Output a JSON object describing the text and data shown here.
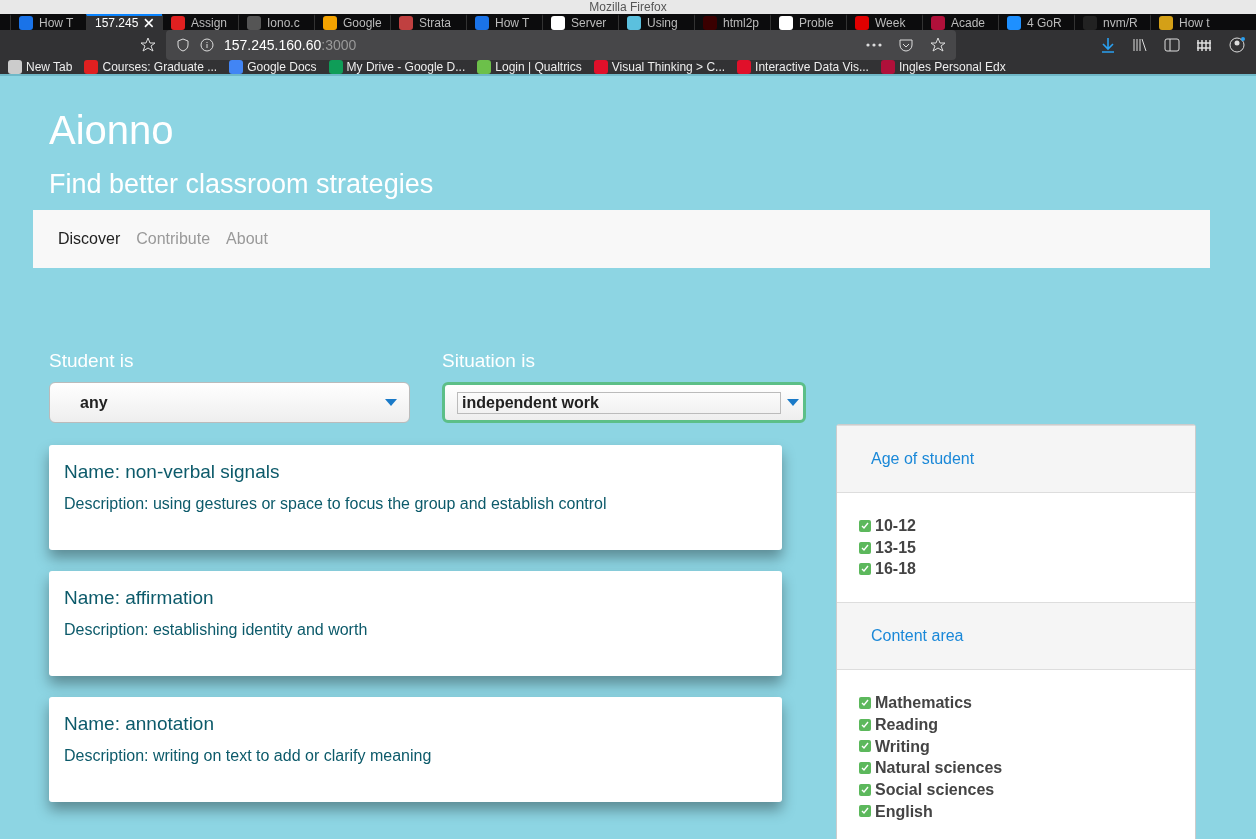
{
  "window": {
    "title": "Mozilla Firefox"
  },
  "tabs": [
    {
      "label": "How T",
      "selected": false,
      "color": "#1a73e8"
    },
    {
      "label": "157.245",
      "selected": true
    },
    {
      "label": "Assign",
      "selected": false,
      "color": "#e02020"
    },
    {
      "label": "Iono.c",
      "selected": false,
      "color": "#555555"
    },
    {
      "label": "Google",
      "selected": false,
      "color": "#f4a300"
    },
    {
      "label": "Strata",
      "selected": false,
      "color": "#c04040"
    },
    {
      "label": "How T",
      "selected": false,
      "color": "#1a73e8"
    },
    {
      "label": "Server",
      "selected": false,
      "color": "#ffffff"
    },
    {
      "label": "Using",
      "selected": false,
      "color": "#5bc0de"
    },
    {
      "label": "html2p",
      "selected": false,
      "color": "#3a0000"
    },
    {
      "label": "Proble",
      "selected": false,
      "color": "#ffffff"
    },
    {
      "label": "Week",
      "selected": false,
      "color": "#e00000"
    },
    {
      "label": "Acade",
      "selected": false,
      "color": "#b0103a"
    },
    {
      "label": "4 GoR",
      "selected": false,
      "color": "#1e90ff"
    },
    {
      "label": "nvm/R",
      "selected": false,
      "color": "#222222"
    },
    {
      "label": "How t",
      "selected": false,
      "color": "#d4a017"
    }
  ],
  "address": {
    "host": "157.245.160.60",
    "port": ":3000"
  },
  "bookmarks": [
    {
      "label": "New Tab",
      "color": "#cccccc"
    },
    {
      "label": "Courses: Graduate ...",
      "color": "#e02020"
    },
    {
      "label": "Google Docs",
      "color": "#4285f4"
    },
    {
      "label": "My Drive - Google D...",
      "color": "#0f9d58"
    },
    {
      "label": "Login | Qualtrics",
      "color": "#6cc04a"
    },
    {
      "label": "Visual Thinking > C...",
      "color": "#e0102a"
    },
    {
      "label": "Interactive Data Vis...",
      "color": "#e0102a"
    },
    {
      "label": "Ingles Personal Edx",
      "color": "#b0103a"
    }
  ],
  "site": {
    "title": "Aionno",
    "subtitle": "Find better classroom strategies"
  },
  "nav": [
    {
      "label": "Discover",
      "selected": true
    },
    {
      "label": "Contribute",
      "selected": false
    },
    {
      "label": "About",
      "selected": false
    }
  ],
  "filters": [
    {
      "label": "Student is",
      "value": "any",
      "focused": false
    },
    {
      "label": "Situation is",
      "value": "independent work",
      "focused": true
    }
  ],
  "strategies": [
    {
      "name": "Name: non-verbal signals",
      "description": "Description: using gestures or space to focus the group and establish control"
    },
    {
      "name": "Name: affirmation",
      "description": "Description: establishing identity and worth"
    },
    {
      "name": "Name: annotation",
      "description": "Description: writing on text to add or clarify meaning"
    }
  ],
  "sidebar": [
    {
      "heading": "Age of student",
      "options": [
        {
          "label": "10-12",
          "checked": true
        },
        {
          "label": "13-15",
          "checked": true
        },
        {
          "label": "16-18",
          "checked": true
        }
      ]
    },
    {
      "heading": "Content area",
      "options": [
        {
          "label": "Mathematics",
          "checked": true
        },
        {
          "label": "Reading",
          "checked": true
        },
        {
          "label": "Writing",
          "checked": true
        },
        {
          "label": "Natural sciences",
          "checked": true
        },
        {
          "label": "Social sciences",
          "checked": true
        },
        {
          "label": "English",
          "checked": true
        }
      ]
    }
  ]
}
